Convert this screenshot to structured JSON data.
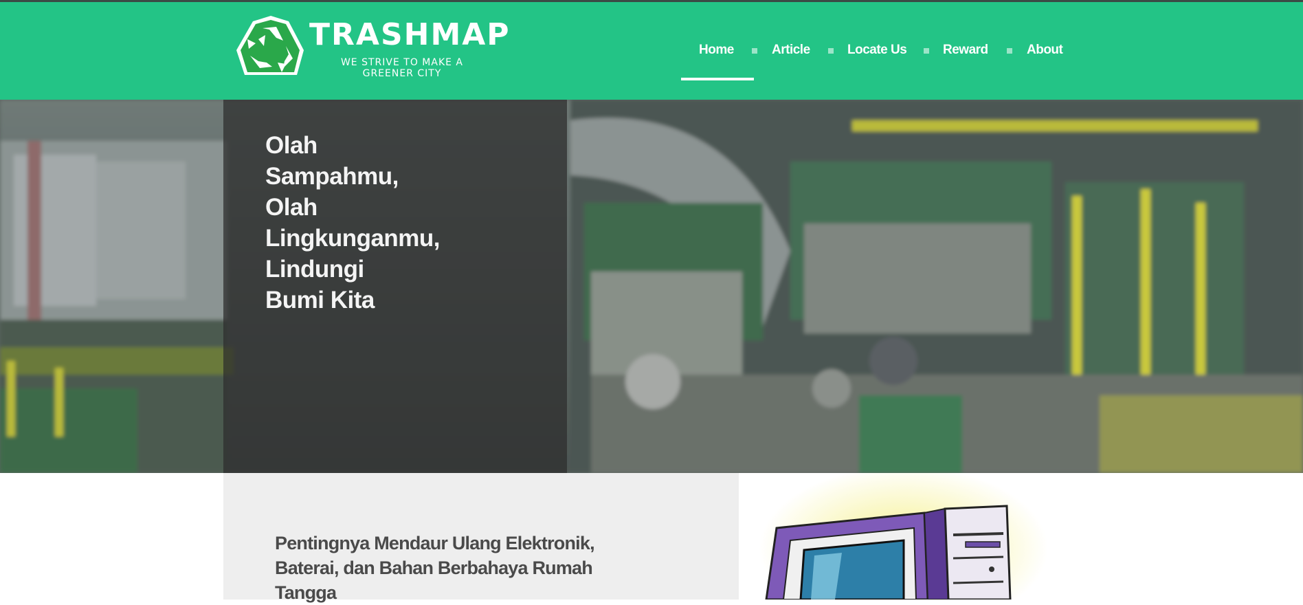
{
  "brand": {
    "name": "TRASHMAP",
    "tagline": "WE STRIVE TO MAKE A GREENER CITY"
  },
  "nav": {
    "items": [
      {
        "label": "Home",
        "active": true
      },
      {
        "label": "Article",
        "active": false
      },
      {
        "label": "Locate Us",
        "active": false
      },
      {
        "label": "Reward",
        "active": false
      },
      {
        "label": "About",
        "active": false
      }
    ]
  },
  "hero": {
    "title_lines": [
      "Olah",
      "Sampahmu,",
      "Olah",
      "Lingkunganmu,",
      "Lindungi",
      "Bumi Kita"
    ]
  },
  "article": {
    "title_lines": [
      "Pentingnya Mendaur Ulang Elektronik,",
      "Baterai, dan Bahan Berbahaya Rumah",
      "Tangga"
    ]
  },
  "colors": {
    "header_green": "#23c486",
    "panel_gray": "#eeeeee",
    "text_dark": "#4a4a4a"
  },
  "icons": {
    "logo": "recycle-logo-icon",
    "hero_image": "recycling-facility-photo",
    "article_image": "computer-illustration"
  }
}
